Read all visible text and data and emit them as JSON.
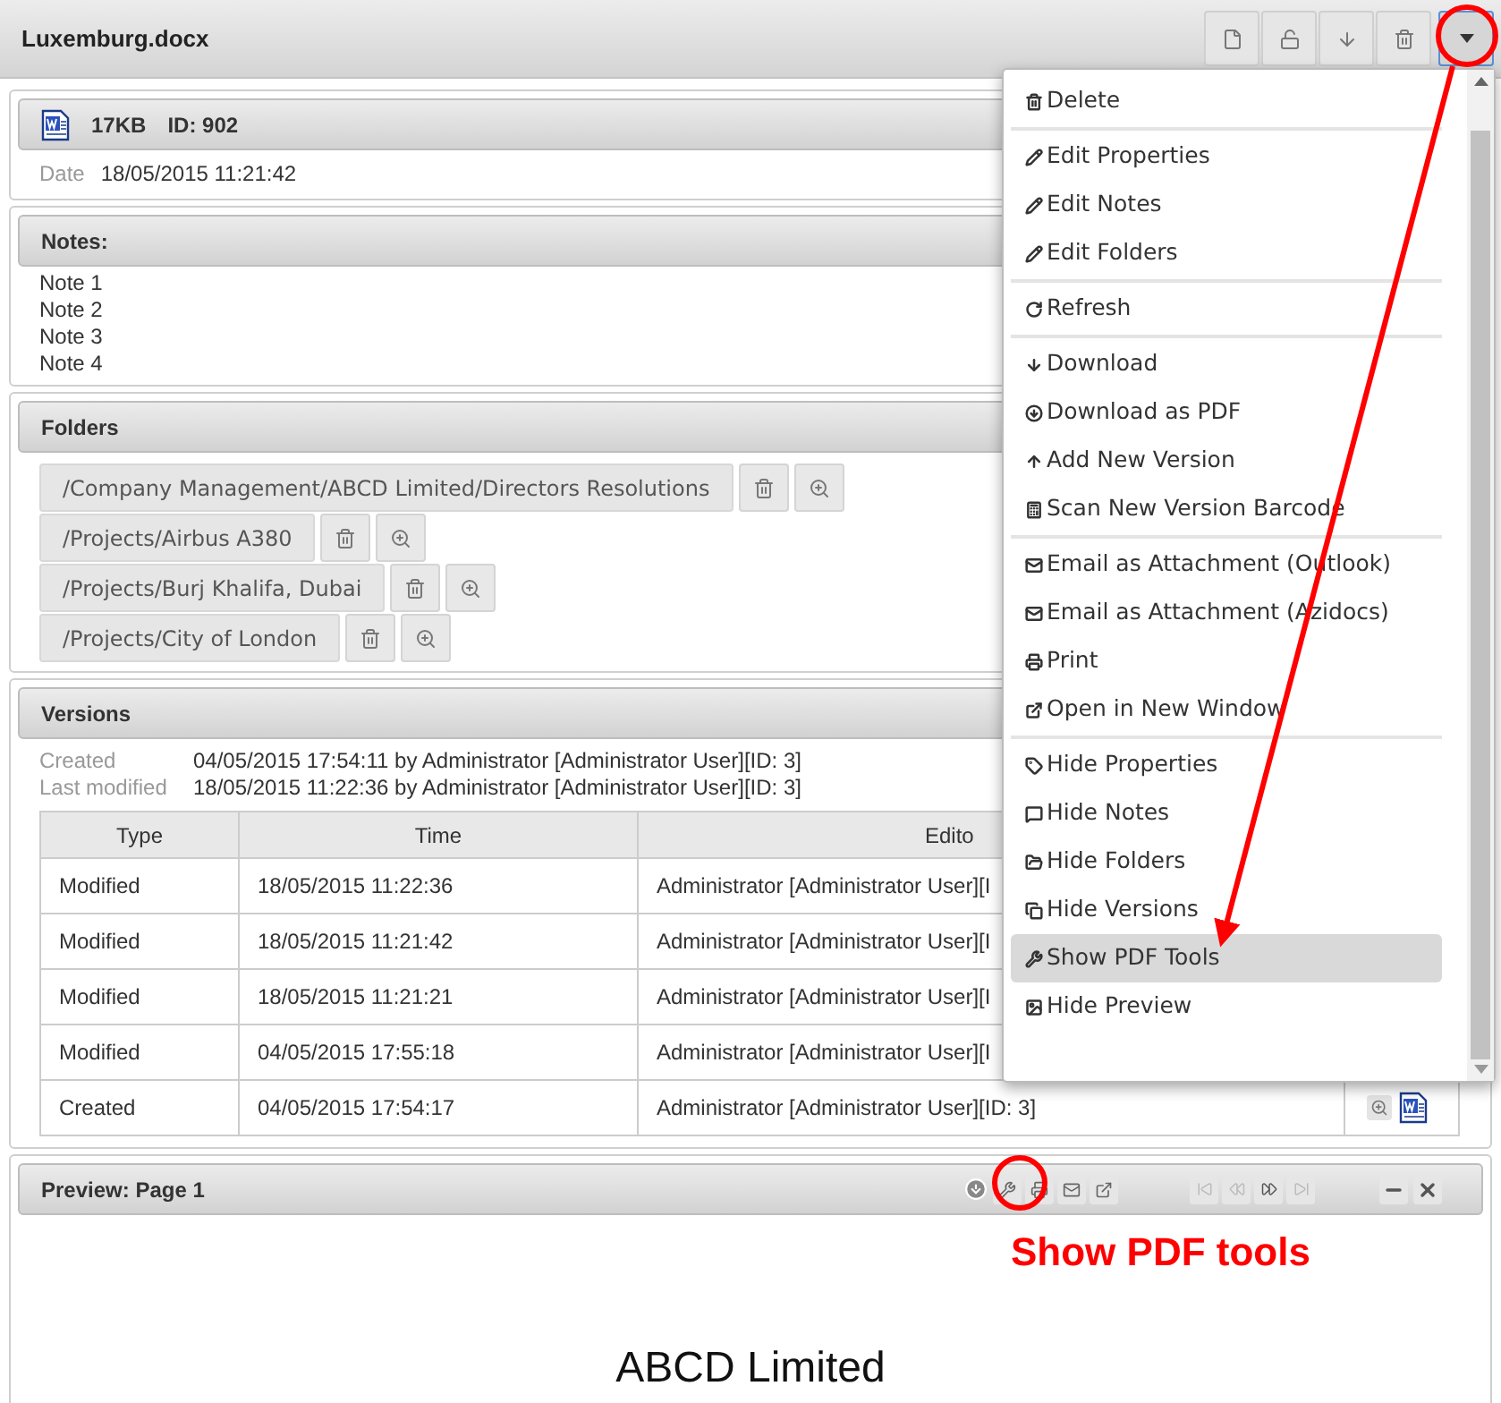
{
  "window": {
    "title": "Luxemburg.docx",
    "menu_button": {
      "pressed": true
    }
  },
  "properties": {
    "size": "17KB",
    "id": "ID: 902",
    "date_label": "Date",
    "date": "18/05/2015 11:21:42"
  },
  "notes": {
    "title": "Notes:",
    "lines": [
      "Note 1",
      "Note 2",
      "Note 3",
      "Note 4"
    ]
  },
  "folders": {
    "title": "Folders",
    "items": [
      "/Company Management/ABCD Limited/Directors Resolutions",
      "/Projects/Airbus A380",
      "/Projects/Burj Khalifa, Dubai",
      "/Projects/City of London"
    ]
  },
  "versions": {
    "title": "Versions",
    "created_label": "Created",
    "created": "04/05/2015 17:54:11 by Administrator [Administrator User][ID: 3]",
    "modified_label": "Last modified",
    "modified": "18/05/2015 11:22:36 by Administrator [Administrator User][ID: 3]",
    "columns": [
      "Type",
      "Time",
      "Edito"
    ],
    "rows": [
      {
        "type": "Modified",
        "time": "18/05/2015 11:22:36",
        "editor": "Administrator [Administrator User][I"
      },
      {
        "type": "Modified",
        "time": "18/05/2015 11:21:42",
        "editor": "Administrator [Administrator User][I"
      },
      {
        "type": "Modified",
        "time": "18/05/2015 11:21:21",
        "editor": "Administrator [Administrator User][I"
      },
      {
        "type": "Modified",
        "time": "04/05/2015 17:55:18",
        "editor": "Administrator [Administrator User][I"
      },
      {
        "type": "Created",
        "time": "04/05/2015 17:54:17",
        "editor": "Administrator [Administrator User][ID: 3]"
      }
    ]
  },
  "preview": {
    "title": "Preview: Page 1",
    "document_heading": "ABCD Limited"
  },
  "menu": {
    "groups": [
      [
        {
          "label": "Delete",
          "selected": false
        }
      ],
      [
        {
          "label": "Edit Properties",
          "selected": false
        },
        {
          "label": "Edit Notes",
          "selected": false
        },
        {
          "label": "Edit Folders",
          "selected": false
        }
      ],
      [
        {
          "label": "Refresh",
          "selected": false
        }
      ],
      [
        {
          "label": "Download",
          "selected": false
        },
        {
          "label": "Download as PDF",
          "selected": false
        },
        {
          "label": "Add New Version",
          "selected": false
        },
        {
          "label": "Scan New Version Barcode",
          "selected": false
        }
      ],
      [
        {
          "label": "Email as Attachment (Outlook)",
          "selected": false
        },
        {
          "label": "Email as Attachment (Azidocs)",
          "selected": false
        },
        {
          "label": "Print",
          "selected": false
        },
        {
          "label": "Open in New Window",
          "selected": false
        }
      ],
      [
        {
          "label": "Hide Properties",
          "selected": false
        },
        {
          "label": "Hide Notes",
          "selected": false
        },
        {
          "label": "Hide Folders",
          "selected": false
        },
        {
          "label": "Hide Versions",
          "selected": false
        },
        {
          "label": "Show PDF Tools",
          "selected": true
        },
        {
          "label": "Hide Preview",
          "selected": false
        }
      ]
    ]
  },
  "annotation": {
    "callout": "Show PDF tools"
  }
}
